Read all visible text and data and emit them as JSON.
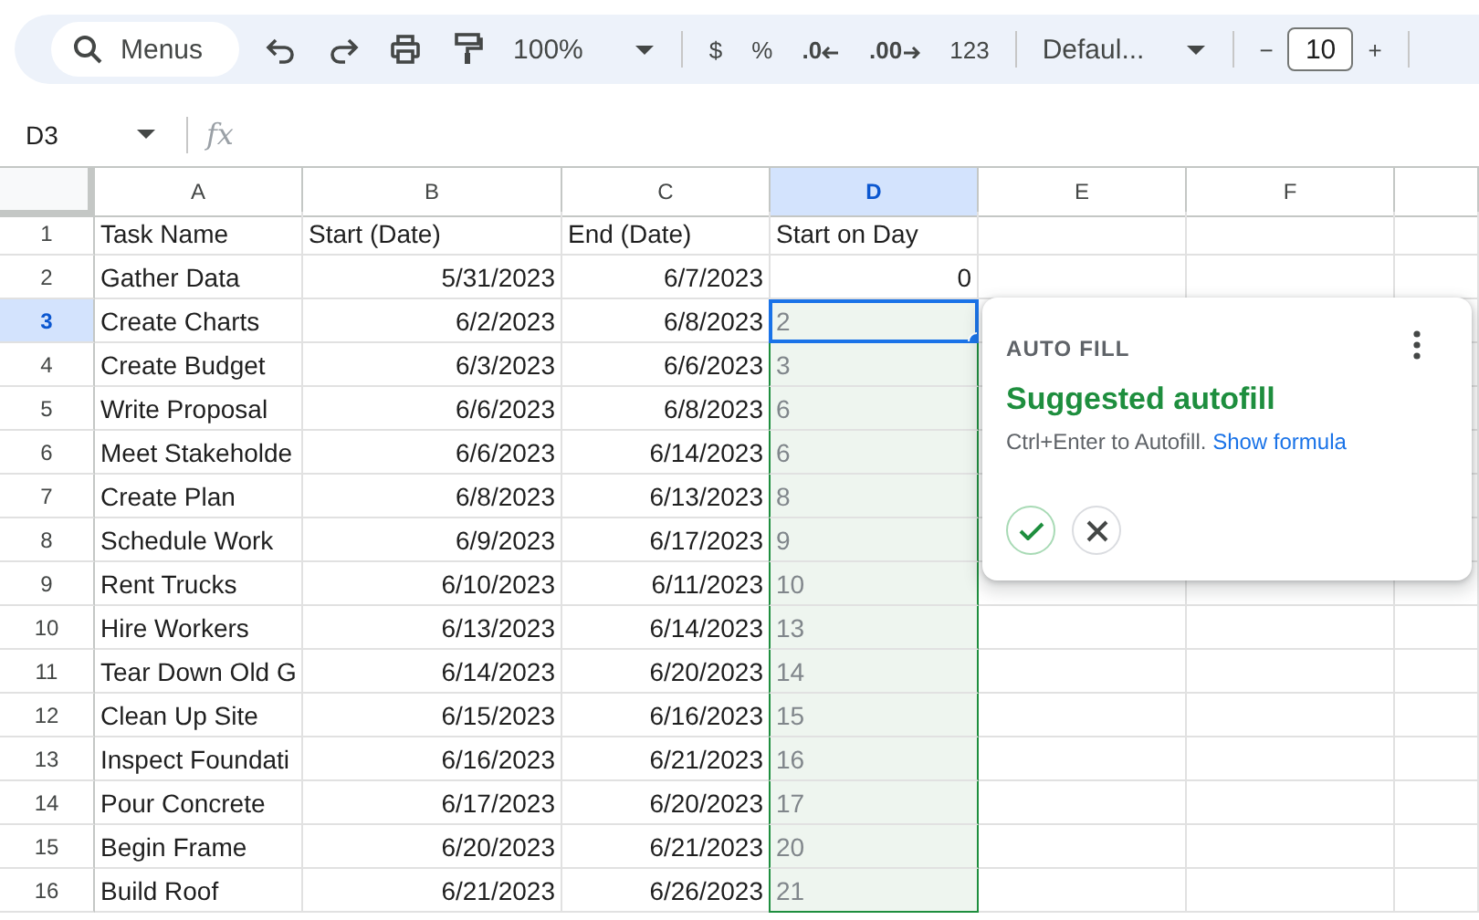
{
  "toolbar": {
    "search": {
      "placeholder": "Menus"
    },
    "zoom": "100%",
    "currency": "$",
    "percent": "%",
    "decrease_decimals": ".0",
    "increase_decimals": ".00",
    "number_format": "123",
    "font": "Defaul...",
    "font_size_decrease": "−",
    "font_size": "10",
    "font_size_increase": "+"
  },
  "formula_bar": {
    "name_box": "D3",
    "fx": "fx"
  },
  "columns": [
    {
      "label": "A",
      "selected": false
    },
    {
      "label": "B",
      "selected": false
    },
    {
      "label": "C",
      "selected": false
    },
    {
      "label": "D",
      "selected": true
    },
    {
      "label": "E",
      "selected": false
    },
    {
      "label": "F",
      "selected": false
    }
  ],
  "rows": [
    {
      "number": "1",
      "selected": false,
      "cells": [
        {
          "kind": "text",
          "text": "Task Name"
        },
        {
          "kind": "text",
          "text": "Start (Date)"
        },
        {
          "kind": "text",
          "text": "End (Date)"
        },
        {
          "kind": "text",
          "text": "Start on Day"
        }
      ]
    },
    {
      "number": "2",
      "selected": false,
      "cells": [
        {
          "kind": "text",
          "text": "Gather Data"
        },
        {
          "kind": "number",
          "text": "5/31/2023"
        },
        {
          "kind": "number",
          "text": "6/7/2023"
        },
        {
          "kind": "number",
          "text": "0"
        }
      ]
    },
    {
      "number": "3",
      "selected": true,
      "cells": [
        {
          "kind": "text",
          "text": "Create Charts"
        },
        {
          "kind": "number",
          "text": "6/2/2023"
        },
        {
          "kind": "number",
          "text": "6/8/2023"
        },
        {
          "kind": "suggestion",
          "text": "2"
        }
      ]
    },
    {
      "number": "4",
      "selected": false,
      "cells": [
        {
          "kind": "text",
          "text": "Create Budget"
        },
        {
          "kind": "number",
          "text": "6/3/2023"
        },
        {
          "kind": "number",
          "text": "6/6/2023"
        },
        {
          "kind": "suggestion",
          "text": "3"
        }
      ]
    },
    {
      "number": "5",
      "selected": false,
      "cells": [
        {
          "kind": "text",
          "text": "Write Proposal"
        },
        {
          "kind": "number",
          "text": "6/6/2023"
        },
        {
          "kind": "number",
          "text": "6/8/2023"
        },
        {
          "kind": "suggestion",
          "text": "6"
        }
      ]
    },
    {
      "number": "6",
      "selected": false,
      "cells": [
        {
          "kind": "text",
          "text": "Meet Stakeholde"
        },
        {
          "kind": "number",
          "text": "6/6/2023"
        },
        {
          "kind": "number",
          "text": "6/14/2023"
        },
        {
          "kind": "suggestion",
          "text": "6"
        }
      ]
    },
    {
      "number": "7",
      "selected": false,
      "cells": [
        {
          "kind": "text",
          "text": "Create Plan"
        },
        {
          "kind": "number",
          "text": "6/8/2023"
        },
        {
          "kind": "number",
          "text": "6/13/2023"
        },
        {
          "kind": "suggestion",
          "text": "8"
        }
      ]
    },
    {
      "number": "8",
      "selected": false,
      "cells": [
        {
          "kind": "text",
          "text": "Schedule Work"
        },
        {
          "kind": "number",
          "text": "6/9/2023"
        },
        {
          "kind": "number",
          "text": "6/17/2023"
        },
        {
          "kind": "suggestion",
          "text": "9"
        }
      ]
    },
    {
      "number": "9",
      "selected": false,
      "cells": [
        {
          "kind": "text",
          "text": "Rent Trucks"
        },
        {
          "kind": "number",
          "text": "6/10/2023"
        },
        {
          "kind": "number",
          "text": "6/11/2023"
        },
        {
          "kind": "suggestion",
          "text": "10"
        }
      ]
    },
    {
      "number": "10",
      "selected": false,
      "cells": [
        {
          "kind": "text",
          "text": "Hire Workers"
        },
        {
          "kind": "number",
          "text": "6/13/2023"
        },
        {
          "kind": "number",
          "text": "6/14/2023"
        },
        {
          "kind": "suggestion",
          "text": "13"
        }
      ]
    },
    {
      "number": "11",
      "selected": false,
      "cells": [
        {
          "kind": "text",
          "text": "Tear Down Old G"
        },
        {
          "kind": "number",
          "text": "6/14/2023"
        },
        {
          "kind": "number",
          "text": "6/20/2023"
        },
        {
          "kind": "suggestion",
          "text": "14"
        }
      ]
    },
    {
      "number": "12",
      "selected": false,
      "cells": [
        {
          "kind": "text",
          "text": "Clean Up Site"
        },
        {
          "kind": "number",
          "text": "6/15/2023"
        },
        {
          "kind": "number",
          "text": "6/16/2023"
        },
        {
          "kind": "suggestion",
          "text": "15"
        }
      ]
    },
    {
      "number": "13",
      "selected": false,
      "cells": [
        {
          "kind": "text",
          "text": "Inspect Foundati"
        },
        {
          "kind": "number",
          "text": "6/16/2023"
        },
        {
          "kind": "number",
          "text": "6/21/2023"
        },
        {
          "kind": "suggestion",
          "text": "16"
        }
      ]
    },
    {
      "number": "14",
      "selected": false,
      "cells": [
        {
          "kind": "text",
          "text": "Pour Concrete"
        },
        {
          "kind": "number",
          "text": "6/17/2023"
        },
        {
          "kind": "number",
          "text": "6/20/2023"
        },
        {
          "kind": "suggestion",
          "text": "17"
        }
      ]
    },
    {
      "number": "15",
      "selected": false,
      "cells": [
        {
          "kind": "text",
          "text": "Begin Frame"
        },
        {
          "kind": "number",
          "text": "6/20/2023"
        },
        {
          "kind": "number",
          "text": "6/21/2023"
        },
        {
          "kind": "suggestion",
          "text": "20"
        }
      ]
    },
    {
      "number": "16",
      "selected": false,
      "cells": [
        {
          "kind": "text",
          "text": "Build Roof"
        },
        {
          "kind": "number",
          "text": "6/21/2023"
        },
        {
          "kind": "number",
          "text": "6/26/2023"
        },
        {
          "kind": "suggestion",
          "text": "21"
        }
      ]
    }
  ],
  "autofill_card": {
    "heading": "AUTO FILL",
    "title": "Suggested autofill",
    "hint": "Ctrl+Enter to Autofill.",
    "link": "Show formula"
  }
}
